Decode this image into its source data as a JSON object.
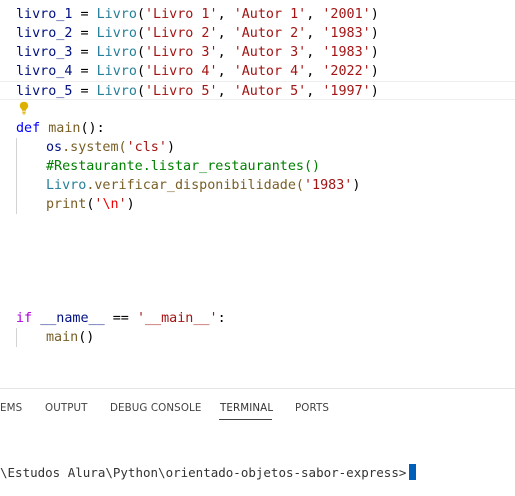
{
  "editor": {
    "lines": [
      {
        "parts": [
          "livro_1",
          " = ",
          "Livro",
          "(",
          "'Livro 1'",
          ", ",
          "'Autor 1'",
          ", ",
          "'2001'",
          ")"
        ]
      },
      {
        "parts": [
          "livro_2",
          " = ",
          "Livro",
          "(",
          "'Livro 2'",
          ", ",
          "'Autor 2'",
          ", ",
          "'1983'",
          ")"
        ]
      },
      {
        "parts": [
          "livro_3",
          " = ",
          "Livro",
          "(",
          "'Livro 3'",
          ", ",
          "'Autor 3'",
          ", ",
          "'1983'",
          ")"
        ]
      },
      {
        "parts": [
          "livro_4",
          " = ",
          "Livro",
          "(",
          "'Livro 4'",
          ", ",
          "'Autor 4'",
          ", ",
          "'2022'",
          ")"
        ]
      },
      {
        "parts": [
          "livro_5",
          " = ",
          "Livro",
          "(",
          "'Livro 5'",
          ", ",
          "'Autor 5'",
          ", ",
          "'1997'",
          ")"
        ]
      }
    ],
    "def_kw": "def",
    "def_name": "main",
    "def_rest": "():",
    "body": {
      "os": "os",
      "system": ".system(",
      "system_arg": "'cls'",
      "system_close": ")",
      "comment": "#Restaurante.listar_restaurantes()",
      "livro_cls": "Livro",
      "verificar": ".verificar_disponibilidade(",
      "verificar_arg": "'1983'",
      "verificar_close": ")",
      "print_fn": "print",
      "print_open": "(",
      "print_q1": "'",
      "print_esc": "\\n",
      "print_q2": "'",
      "print_close": ")"
    },
    "if_kw": "if",
    "if_name": "__name__",
    "if_op": " == ",
    "if_q1": "'",
    "if_main": "__main__",
    "if_q2": "'",
    "if_colon": ":",
    "main_call": "main",
    "main_parens": "()",
    "bulb_icon": "lightbulb-icon"
  },
  "panel": {
    "tabs": [
      {
        "label": "EMS"
      },
      {
        "label": "OUTPUT"
      },
      {
        "label": "DEBUG CONSOLE"
      },
      {
        "label": "TERMINAL",
        "active": true
      },
      {
        "label": "PORTS"
      }
    ],
    "terminal_prompt": "\\Estudos Alura\\Python\\orientado-objetos-sabor-express>"
  },
  "colors": {
    "accent": "#005fb8",
    "lightbulb": "#ddb100"
  }
}
